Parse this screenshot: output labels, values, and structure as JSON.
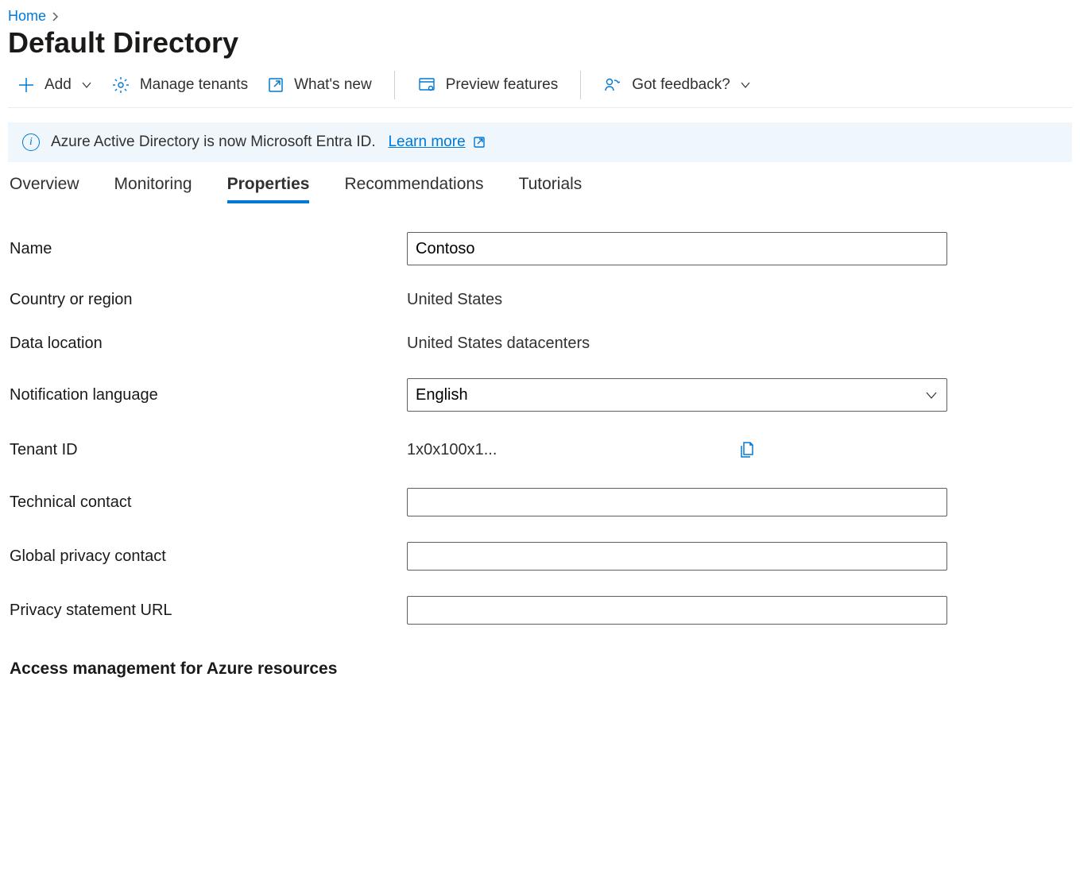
{
  "breadcrumb": {
    "home": "Home"
  },
  "page_title": "Default Directory",
  "toolbar": {
    "add": "Add",
    "manage_tenants": "Manage tenants",
    "whats_new": "What's new",
    "preview_features": "Preview features",
    "got_feedback": "Got feedback?"
  },
  "info_bar": {
    "text": "Azure Active Directory is now Microsoft Entra ID.",
    "link": "Learn more"
  },
  "tabs": {
    "overview": "Overview",
    "monitoring": "Monitoring",
    "properties": "Properties",
    "recommendations": "Recommendations",
    "tutorials": "Tutorials"
  },
  "form": {
    "name_label": "Name",
    "name_value": "Contoso",
    "country_label": "Country or region",
    "country_value": "United States",
    "data_location_label": "Data location",
    "data_location_value": "United States datacenters",
    "notification_language_label": "Notification language",
    "notification_language_value": "English",
    "tenant_id_label": "Tenant ID",
    "tenant_id_value": "1x0x100x1...",
    "technical_contact_label": "Technical contact",
    "technical_contact_value": "",
    "global_privacy_contact_label": "Global privacy contact",
    "global_privacy_contact_value": "",
    "privacy_statement_url_label": "Privacy statement URL",
    "privacy_statement_url_value": ""
  },
  "section_heading": "Access management for Azure resources"
}
